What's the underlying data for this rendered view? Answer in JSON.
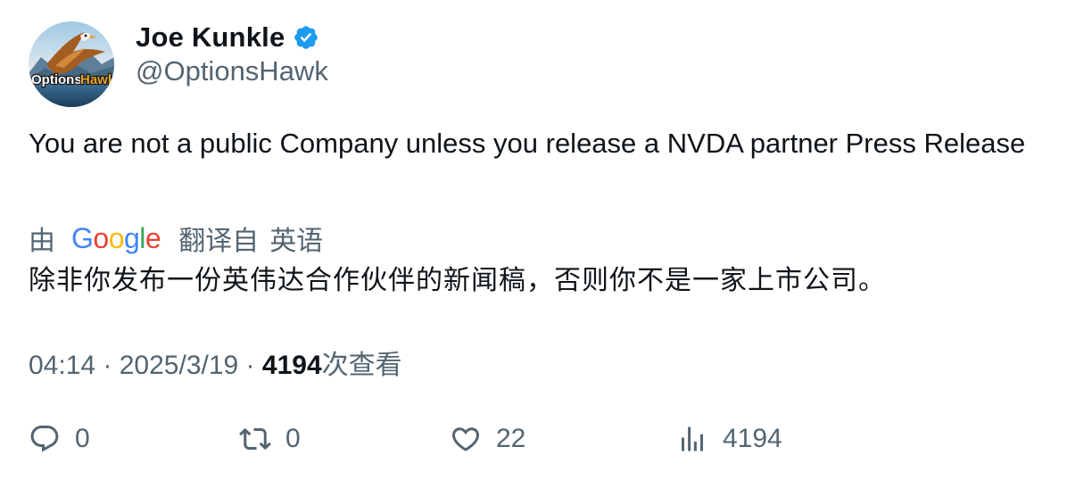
{
  "author": {
    "display_name": "Joe Kunkle",
    "handle": "@OptionsHawk",
    "avatar_text": "OptionsHawk",
    "verified": true,
    "verified_color": "#1d9bf0"
  },
  "tweet": {
    "text": "You are not a public Company unless you release a NVDA partner Press Release"
  },
  "translation": {
    "by_label": "由",
    "provider": "Google",
    "from_label": "翻译自",
    "language": "英语",
    "text": "除非你发布一份英伟达合作伙伴的新闻稿，否则你不是一家上市公司。"
  },
  "meta": {
    "time": "04:14",
    "separator": " · ",
    "date": "2025/3/19",
    "views_count": "4194",
    "views_label": "次查看"
  },
  "actions": {
    "reply": {
      "icon": "reply-icon",
      "count": "0"
    },
    "retweet": {
      "icon": "retweet-icon",
      "count": "0"
    },
    "like": {
      "icon": "heart-icon",
      "count": "22"
    },
    "views": {
      "icon": "analytics-icon",
      "count": "4194"
    }
  },
  "colors": {
    "text_primary": "#0f1419",
    "text_secondary": "#536471",
    "google_blue": "#4285f4",
    "google_red": "#ea4335",
    "google_yellow": "#fbbc05",
    "google_green": "#34a853"
  }
}
